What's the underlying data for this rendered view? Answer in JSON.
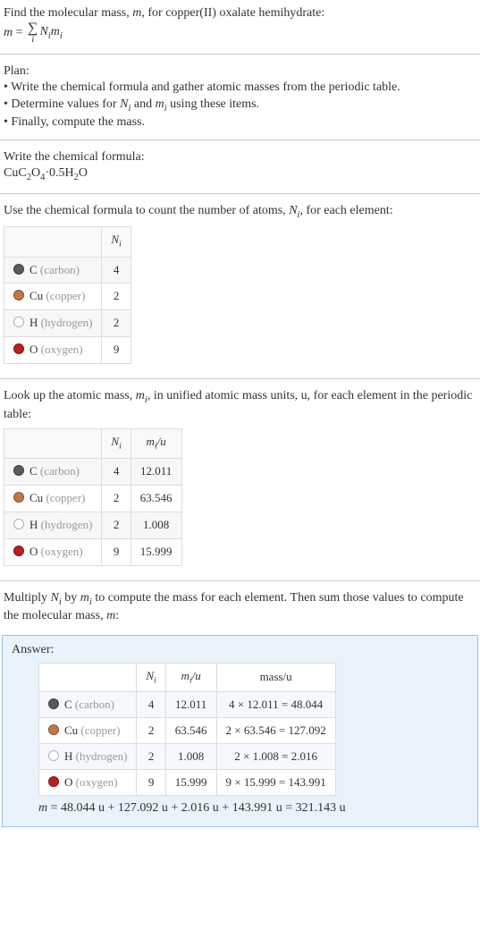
{
  "intro": {
    "line1_a": "Find the molecular mass, ",
    "line1_b": ", for copper(II) oxalate hemihydrate:"
  },
  "plan": {
    "title": "Plan:",
    "items": [
      "Write the chemical formula and gather atomic masses from the periodic table.",
      "Finally, compute the mass."
    ],
    "item2_a": "Determine values for ",
    "item2_b": " and ",
    "item2_c": " using these items."
  },
  "formula_section": {
    "title": "Write the chemical formula:"
  },
  "count_section": {
    "text_a": "Use the chemical formula to count the number of atoms, ",
    "text_b": ", for each element:"
  },
  "mass_section": {
    "text_a": "Look up the atomic mass, ",
    "text_b": ", in unified atomic mass units, u, for each element in the periodic table:"
  },
  "multiply_section": {
    "text_a": "Multiply ",
    "text_b": " by ",
    "text_c": " to compute the mass for each element. Then sum those values to compute the molecular mass, ",
    "text_d": ":"
  },
  "answer": {
    "title": "Answer:"
  },
  "headers": {
    "Ni": "N",
    "mi_u": "m",
    "per_u": "/u",
    "mass_u": "mass/u"
  },
  "elements": [
    {
      "sym": "C",
      "name": "(carbon)",
      "color": "#5a5a5a",
      "N": 4,
      "m": "12.011",
      "mass_expr": "4 × 12.011 = 48.044"
    },
    {
      "sym": "Cu",
      "name": "(copper)",
      "color": "#c07848",
      "N": 2,
      "m": "63.546",
      "mass_expr": "2 × 63.546 = 127.092"
    },
    {
      "sym": "H",
      "name": "(hydrogen)",
      "color": "#ffffff",
      "N": 2,
      "m": "1.008",
      "mass_expr": "2 × 1.008 = 2.016"
    },
    {
      "sym": "O",
      "name": "(oxygen)",
      "color": "#b82020",
      "N": 9,
      "m": "15.999",
      "mass_expr": "9 × 15.999 = 143.991"
    }
  ],
  "final_line_a": " = 48.044 u + 127.092 u + 2.016 u + 143.991 u = 321.143 u",
  "chart_data": {
    "type": "table",
    "compound": "copper(II) oxalate hemihydrate",
    "chemical_formula": "CuC2O4·0.5H2O",
    "rows": [
      {
        "element": "C (carbon)",
        "N_i": 4,
        "m_i_u": 12.011,
        "mass_u": 48.044
      },
      {
        "element": "Cu (copper)",
        "N_i": 2,
        "m_i_u": 63.546,
        "mass_u": 127.092
      },
      {
        "element": "H (hydrogen)",
        "N_i": 2,
        "m_i_u": 1.008,
        "mass_u": 2.016
      },
      {
        "element": "O (oxygen)",
        "N_i": 9,
        "m_i_u": 15.999,
        "mass_u": 143.991
      }
    ],
    "molecular_mass_u": 321.143
  }
}
